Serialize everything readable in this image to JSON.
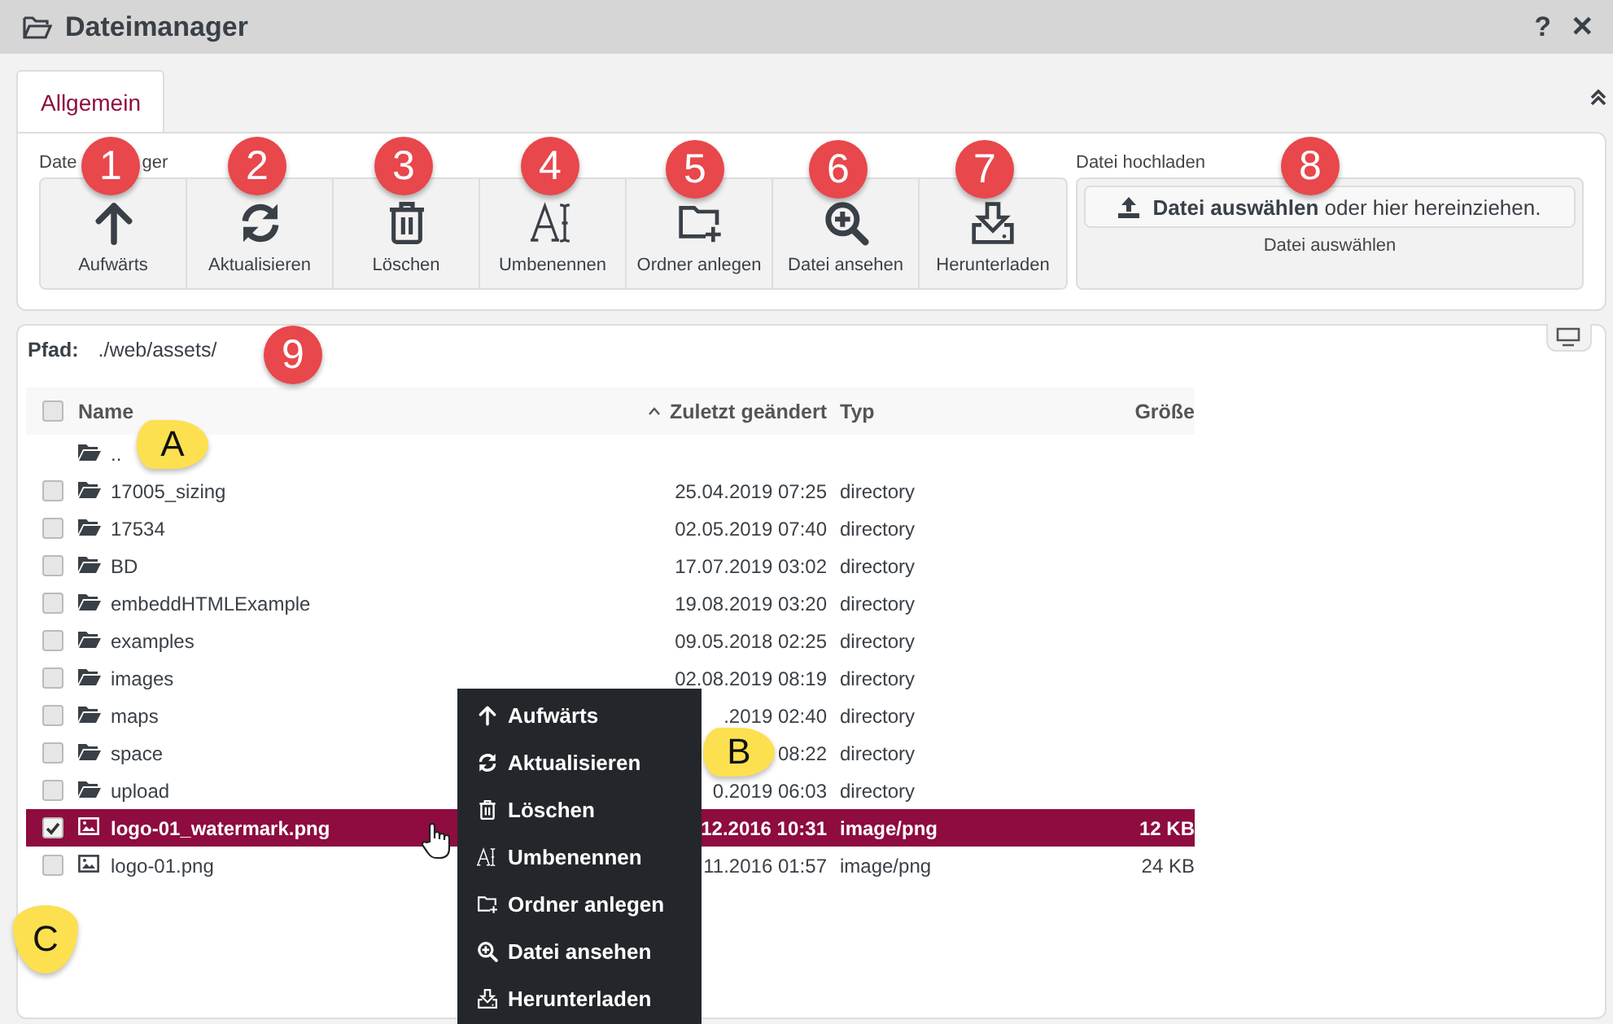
{
  "window": {
    "title": "Dateimanager",
    "buttons": [
      "?",
      "✕"
    ]
  },
  "tabs": [
    {
      "label": "Allgemein",
      "selected": true
    }
  ],
  "toolbar": {
    "label_parts": [
      "Date",
      "ger"
    ],
    "buttons": [
      {
        "label": "Aufwärts",
        "kind": "up"
      },
      {
        "label": "Aktualisieren",
        "kind": "refresh"
      },
      {
        "label": "Löschen",
        "kind": "trash"
      },
      {
        "label": "Umbenennen",
        "kind": "rename"
      },
      {
        "label": "Ordner anlegen",
        "kind": "folder-plus"
      },
      {
        "label": "Datei ansehen",
        "kind": "zoom"
      },
      {
        "label": "Herunterladen",
        "kind": "download"
      }
    ]
  },
  "upload": {
    "label": "Datei hochladen",
    "button": "**Datei auswählen** oder hier hereinziehen.",
    "hint": "Datei auswählen"
  },
  "path": {
    "label": "Pfad:",
    "value": "./web/assets/"
  },
  "table": {
    "select_all": {
      "checked": false
    },
    "columns": [
      "Name",
      "Zuletzt geändert",
      "Typ",
      "Größe"
    ],
    "rows": [
      {
        "kind": "parent",
        "name": "..",
        "selected": false
      },
      {
        "kind": "folder",
        "name": "17005_sizing",
        "modified": "25.04.2019 07:25",
        "type": "directory",
        "checked": false,
        "selected": false
      },
      {
        "kind": "folder",
        "name": "17534",
        "modified": "02.05.2019 07:40",
        "type": "directory",
        "checked": false,
        "selected": false
      },
      {
        "kind": "folder",
        "name": "BD",
        "modified": "17.07.2019 03:02",
        "type": "directory",
        "checked": false,
        "selected": false
      },
      {
        "kind": "folder",
        "name": "embeddHTMLExample",
        "modified": "19.08.2019 03:20",
        "type": "directory",
        "checked": false,
        "selected": false
      },
      {
        "kind": "folder",
        "name": "examples",
        "modified": "09.05.2018 02:25",
        "type": "directory",
        "checked": false,
        "selected": false
      },
      {
        "kind": "folder",
        "name": "images",
        "modified": "02.08.2019 08:19",
        "type": "directory",
        "checked": false,
        "selected": false
      },
      {
        "kind": "folder",
        "name": "maps",
        "modified": ".2019 02:40",
        "type": "directory",
        "checked": false,
        "selected": false
      },
      {
        "kind": "folder",
        "name": "space",
        "modified": "08:22",
        "type": "directory",
        "checked": false,
        "selected": false
      },
      {
        "kind": "folder",
        "name": "upload",
        "modified": "0.2019 06:03",
        "type": "directory",
        "checked": false,
        "selected": false
      },
      {
        "kind": "image",
        "name": "logo-01_watermark.png",
        "modified": "12.2016 10:31",
        "type": "image/png",
        "size": "12 KB",
        "checked": true,
        "selected": true
      },
      {
        "kind": "image",
        "name": "logo-01.png",
        "modified": "11.2016 01:57",
        "type": "image/png",
        "size": "24 KB",
        "checked": false,
        "selected": false
      }
    ]
  },
  "context_menu": [
    {
      "label": "Aufwärts",
      "kind": "up"
    },
    {
      "label": "Aktualisieren",
      "kind": "refresh"
    },
    {
      "label": "Löschen",
      "kind": "trash"
    },
    {
      "label": "Umbenennen",
      "kind": "rename"
    },
    {
      "label": "Ordner anlegen",
      "kind": "folder-plus"
    },
    {
      "label": "Datei ansehen",
      "kind": "zoom"
    },
    {
      "label": "Herunterladen",
      "kind": "download"
    }
  ],
  "callouts": [
    {
      "label": "1",
      "kind": "number"
    },
    {
      "label": "2",
      "kind": "number"
    },
    {
      "label": "3",
      "kind": "number"
    },
    {
      "label": "4",
      "kind": "number"
    },
    {
      "label": "5",
      "kind": "number"
    },
    {
      "label": "6",
      "kind": "number"
    },
    {
      "label": "7",
      "kind": "number"
    },
    {
      "label": "8",
      "kind": "number"
    },
    {
      "label": "9",
      "kind": "number"
    },
    {
      "label": "A",
      "kind": "pin"
    },
    {
      "label": "B",
      "kind": "pin"
    },
    {
      "label": "C",
      "kind": "pin"
    }
  ]
}
